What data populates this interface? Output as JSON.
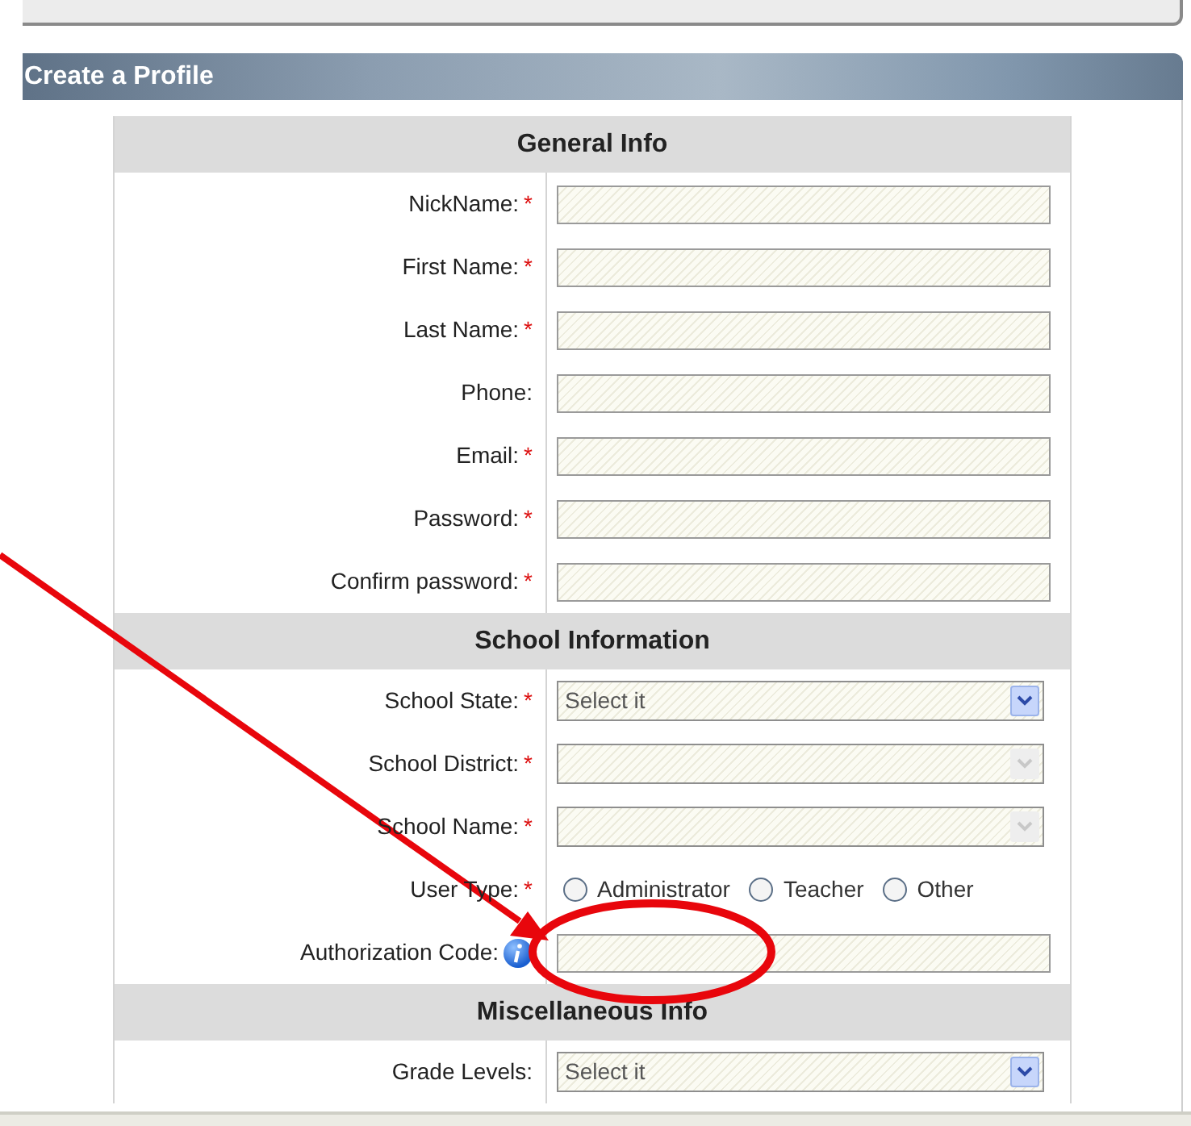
{
  "panel_title": "Create a Profile",
  "sections": [
    {
      "title": "General Info",
      "fields": [
        {
          "label": "NickName:",
          "required_mark": "*",
          "kind": "text"
        },
        {
          "label": "First Name:",
          "required_mark": "*",
          "kind": "text"
        },
        {
          "label": "Last Name:",
          "required_mark": "*",
          "kind": "text"
        },
        {
          "label": "Phone:",
          "kind": "text"
        },
        {
          "label": "Email:",
          "required_mark": "*",
          "kind": "text"
        },
        {
          "label": "Password:",
          "required_mark": "*",
          "kind": "text"
        },
        {
          "label": "Confirm password:",
          "required_mark": "*",
          "kind": "text"
        }
      ]
    },
    {
      "title": "School Information",
      "fields": [
        {
          "label": "School State:",
          "required_mark": "*",
          "kind": "select",
          "value": "Select it",
          "disabled": false
        },
        {
          "label": "School District:",
          "required_mark": "*",
          "kind": "select",
          "disabled": true
        },
        {
          "label": "School Name:",
          "required_mark": "*",
          "kind": "select",
          "disabled": true
        },
        {
          "label": "User Type:",
          "required_mark": "*",
          "kind": "radio",
          "options": [
            {
              "label": "Administrator",
              "selected": false
            },
            {
              "label": "Teacher",
              "selected": false
            },
            {
              "label": "Other",
              "selected": false
            }
          ]
        },
        {
          "label": "Authorization Code:",
          "kind": "text",
          "info": true
        }
      ]
    },
    {
      "title": "Miscellaneous Info",
      "fields": [
        {
          "label": "Grade Levels:",
          "kind": "select",
          "value": "Select it",
          "disabled": false
        }
      ]
    }
  ]
}
